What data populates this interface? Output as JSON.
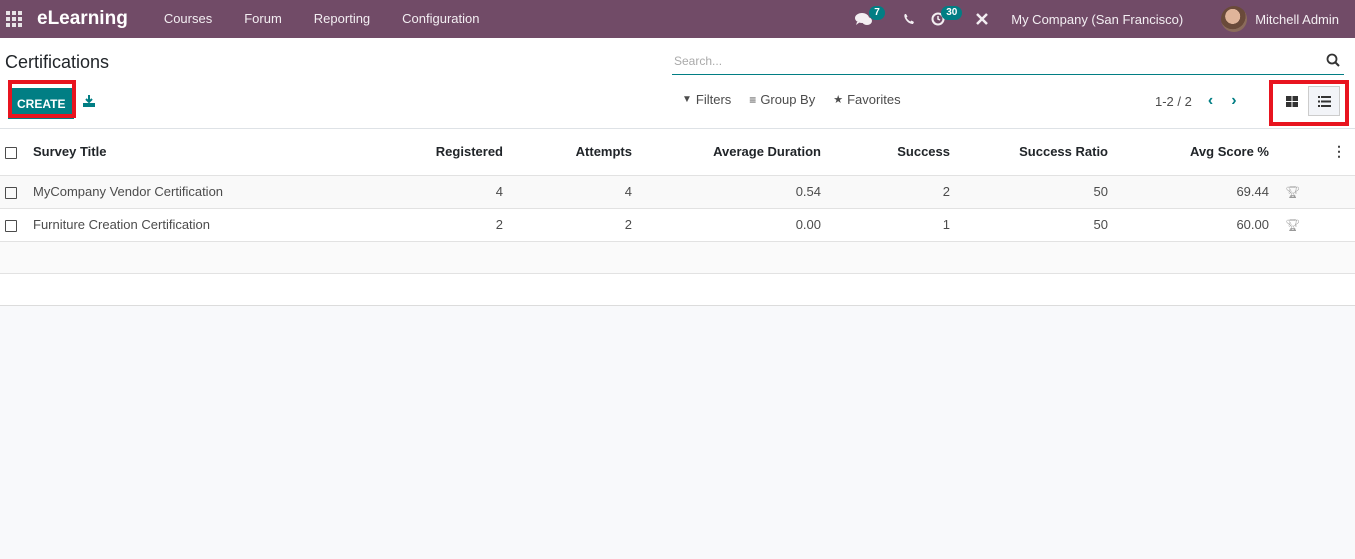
{
  "navbar": {
    "app_name": "eLearning",
    "menu": [
      "Courses",
      "Forum",
      "Reporting",
      "Configuration"
    ],
    "messages_count": "7",
    "activities_count": "30",
    "company": "My Company (San Francisco)",
    "user": "Mitchell Admin",
    "brand_color": "#714b67",
    "badge_color": "#017e84"
  },
  "control_panel": {
    "title": "Certifications",
    "create_label": "CREATE",
    "search_placeholder": "Search...",
    "filters_label": "Filters",
    "groupby_label": "Group By",
    "favorites_label": "Favorites",
    "pager": "1-2 / 2",
    "active_view": "list"
  },
  "table": {
    "columns": [
      "Survey Title",
      "Registered",
      "Attempts",
      "Average Duration",
      "Success",
      "Success Ratio",
      "Avg Score %"
    ],
    "rows": [
      {
        "title": "MyCompany Vendor Certification",
        "registered": "4",
        "attempts": "4",
        "avg_duration": "0.54",
        "success": "2",
        "success_ratio": "50",
        "avg_score": "69.44"
      },
      {
        "title": "Furniture Creation Certification",
        "registered": "2",
        "attempts": "2",
        "avg_duration": "0.00",
        "success": "1",
        "success_ratio": "50",
        "avg_score": "60.00"
      }
    ]
  },
  "highlight_color": "#e8141f"
}
